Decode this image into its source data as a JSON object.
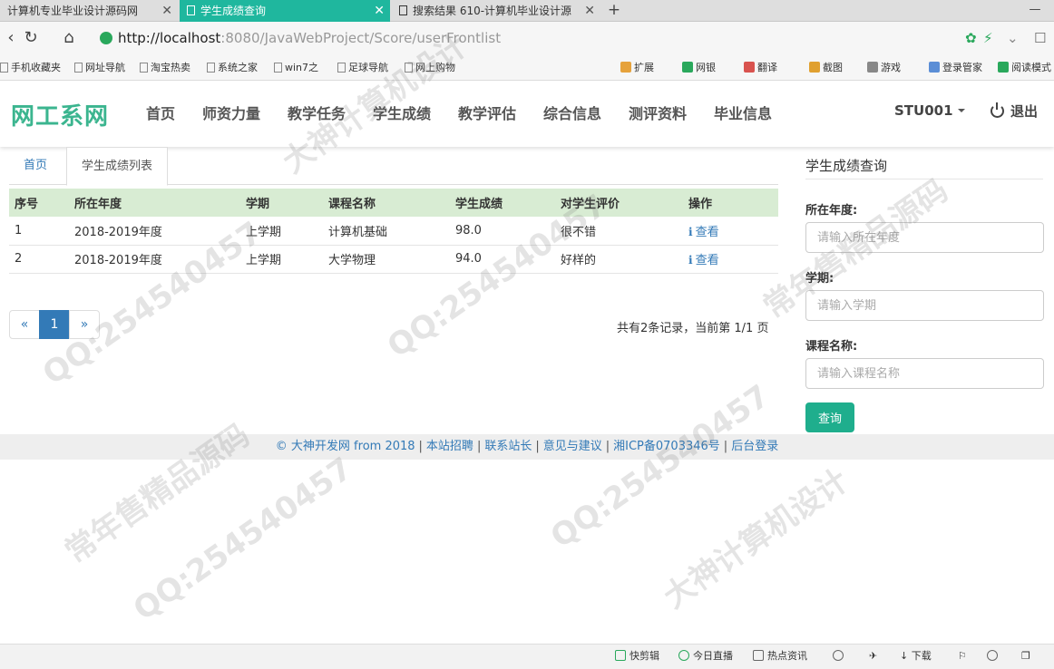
{
  "browser": {
    "tabs": [
      {
        "label": "计算机专业毕业设计源码网",
        "active": false
      },
      {
        "label": "学生成绩查询",
        "active": true
      },
      {
        "label": "搜索结果 610-计算机毕业设计源",
        "active": false
      }
    ],
    "url_host": "http://localhost",
    "url_rest": ":8080/JavaWebProject/Score/userFrontlist",
    "bookmarks": [
      "手机收藏夹",
      "网址导航",
      "淘宝热卖",
      "系统之家",
      "win7之",
      "足球导航",
      "网上购物"
    ],
    "tools": [
      "扩展",
      "网银",
      "翻译",
      "截图",
      "游戏",
      "登录管家",
      "阅读模式"
    ]
  },
  "site": {
    "logo": "网工系网",
    "menu": [
      "首页",
      "师资力量",
      "教学任务",
      "学生成绩",
      "教学评估",
      "综合信息",
      "测评资料",
      "毕业信息"
    ],
    "user": "STU001",
    "logout": "退出"
  },
  "content_tabs": {
    "home": "首页",
    "current": "学生成绩列表"
  },
  "table": {
    "headers": [
      "序号",
      "所在年度",
      "学期",
      "课程名称",
      "学生成绩",
      "对学生评价",
      "操作"
    ],
    "rows": [
      {
        "no": "1",
        "year": "2018-2019年度",
        "term": "上学期",
        "course": "计算机基础",
        "score": "98.0",
        "comment": "很不错",
        "action": "查看"
      },
      {
        "no": "2",
        "year": "2018-2019年度",
        "term": "上学期",
        "course": "大学物理",
        "score": "94.0",
        "comment": "好样的",
        "action": "查看"
      }
    ]
  },
  "pagination": {
    "prev": "«",
    "current": "1",
    "next": "»",
    "info": "共有2条记录，当前第 1/1 页"
  },
  "search_panel": {
    "title": "学生成绩查询",
    "year_label": "所在年度:",
    "year_placeholder": "请输入所在年度",
    "term_label": "学期:",
    "term_placeholder": "请输入学期",
    "course_label": "课程名称:",
    "course_placeholder": "请输入课程名称",
    "submit": "查询"
  },
  "footer": {
    "links": [
      "© 大神开发网 from 2018",
      "本站招聘",
      "联系站长",
      "意见与建议",
      "湘ICP备0703346号",
      "后台登录"
    ]
  },
  "statusbar": [
    "快剪辑",
    "今日直播",
    "热点资讯",
    "下载"
  ],
  "watermarks": [
    "QQ:254540457",
    "大神计算机设计",
    "常年售精品源码"
  ],
  "colors": {
    "accent": "#1fae8d",
    "logo": "#3bb58f",
    "link": "#337ab7",
    "table_header": "#d8ecd3"
  }
}
